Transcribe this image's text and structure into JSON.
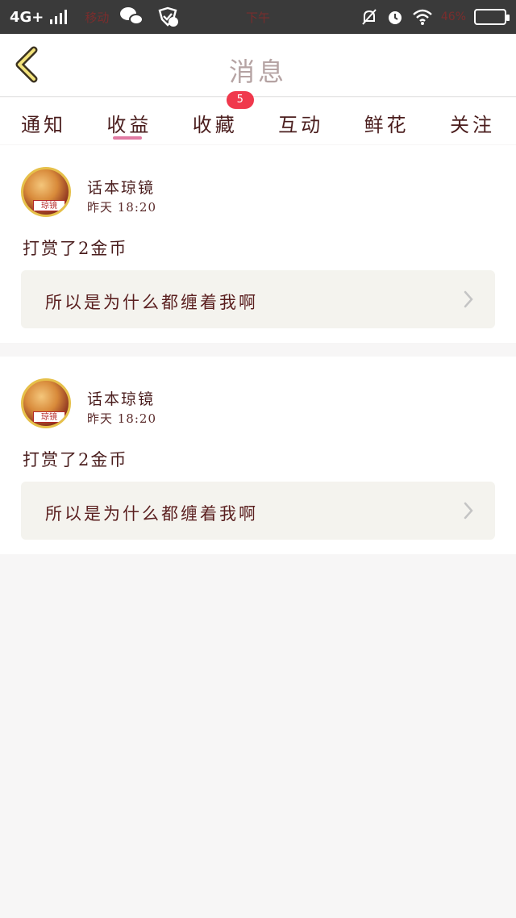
{
  "status_bar": {
    "network": "4G+",
    "carrier": "移动",
    "time": "下午",
    "battery_percent": "46%",
    "battery_color": "#f3b21c",
    "icons": [
      "signal-icon",
      "wechat-icon",
      "shield-badge-icon",
      "mute-bell-icon",
      "alarm-icon",
      "wifi-icon",
      "battery-icon"
    ]
  },
  "header": {
    "back_icon": "chevron-left-icon",
    "title": "消息"
  },
  "tabs": [
    {
      "label": "通知",
      "active": false
    },
    {
      "label": "收益",
      "active": true
    },
    {
      "label": "收藏",
      "active": false,
      "badge": "5"
    },
    {
      "label": "互动",
      "active": false
    },
    {
      "label": "鲜花",
      "active": false
    },
    {
      "label": "关注",
      "active": false
    }
  ],
  "accent_color": "#e17aa2",
  "badge_color": "#f0384c",
  "messages": [
    {
      "user": "话本琼镜",
      "time": "昨天 18:20",
      "text": "打赏了2金币",
      "reference": "所以是为什么都缠着我啊",
      "avatar_tag": "琼镜"
    },
    {
      "user": "话本琼镜",
      "time": "昨天 18:20",
      "text": "打赏了2金币",
      "reference": "所以是为什么都缠着我啊",
      "avatar_tag": "琼镜"
    }
  ]
}
